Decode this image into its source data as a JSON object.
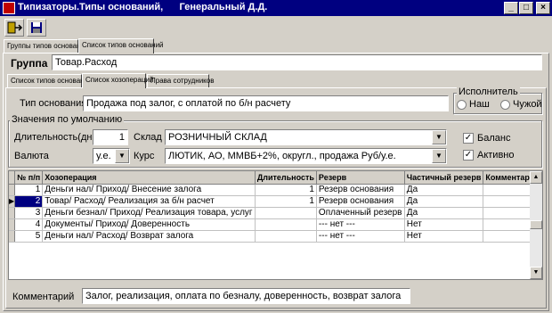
{
  "window": {
    "title": "Типизаторы.Типы оснований,      Генеральный Д.Д.",
    "minimize": "_",
    "maximize": "□",
    "close": "×"
  },
  "outer_tabs": [
    "Группы типов оснований",
    "Список типов оснований"
  ],
  "group": {
    "label": "Группа",
    "value": "Товар.Расход"
  },
  "inner_tabs": [
    "Список типов оснований",
    "Список хозопераций",
    "Права сотрудников"
  ],
  "type_basis": {
    "label": "Тип основания",
    "value": "Продажа под залог, с оплатой по б/н расчету"
  },
  "executor": {
    "legend": "Исполнитель",
    "options": [
      "Наш",
      "Чужой"
    ]
  },
  "defaults": {
    "legend": "Значения по умолчанию",
    "duration_label": "Длительность(дн.",
    "duration_value": "1",
    "warehouse_label": "Склад",
    "warehouse_value": "РОЗНИЧНЫЙ СКЛАД",
    "currency_label": "Валюта",
    "currency_value": "у.е.",
    "rate_label": "Курс",
    "rate_value": "ЛЮТИК, АО, ММВБ+2%, округл., продажа Руб/у.е.",
    "balance_label": "Баланс",
    "active_label": "Активно"
  },
  "table": {
    "columns": [
      "№ п/п",
      "Хозоперация",
      "Длительность",
      "Резерв",
      "Частичный резерв",
      "Комментарий"
    ],
    "rows": [
      [
        "1",
        "Деньги нал/ Приход/ Внесение залога",
        "1",
        "Резерв основания",
        "Да",
        ""
      ],
      [
        "2",
        "Товар/ Расход/ Реализация за б/н расчет",
        "1",
        "Резерв основания",
        "Да",
        ""
      ],
      [
        "3",
        "Деньги безнал/ Приход/ Реализация товара, услуг",
        "",
        "Оплаченный резерв",
        "Да",
        ""
      ],
      [
        "4",
        "Документы/ Приход/ Доверенность",
        "",
        "--- нет ---",
        "Нет",
        ""
      ],
      [
        "5",
        "Деньги нал/ Расход/ Возврат залога",
        "",
        "--- нет ---",
        "Нет",
        ""
      ]
    ],
    "selected_row": 1
  },
  "comment": {
    "label": "Комментарий",
    "value": "Залог, реализация, оплата по безналу, доверенность, возврат залога"
  },
  "icons": [
    "exit-icon",
    "save-icon"
  ]
}
